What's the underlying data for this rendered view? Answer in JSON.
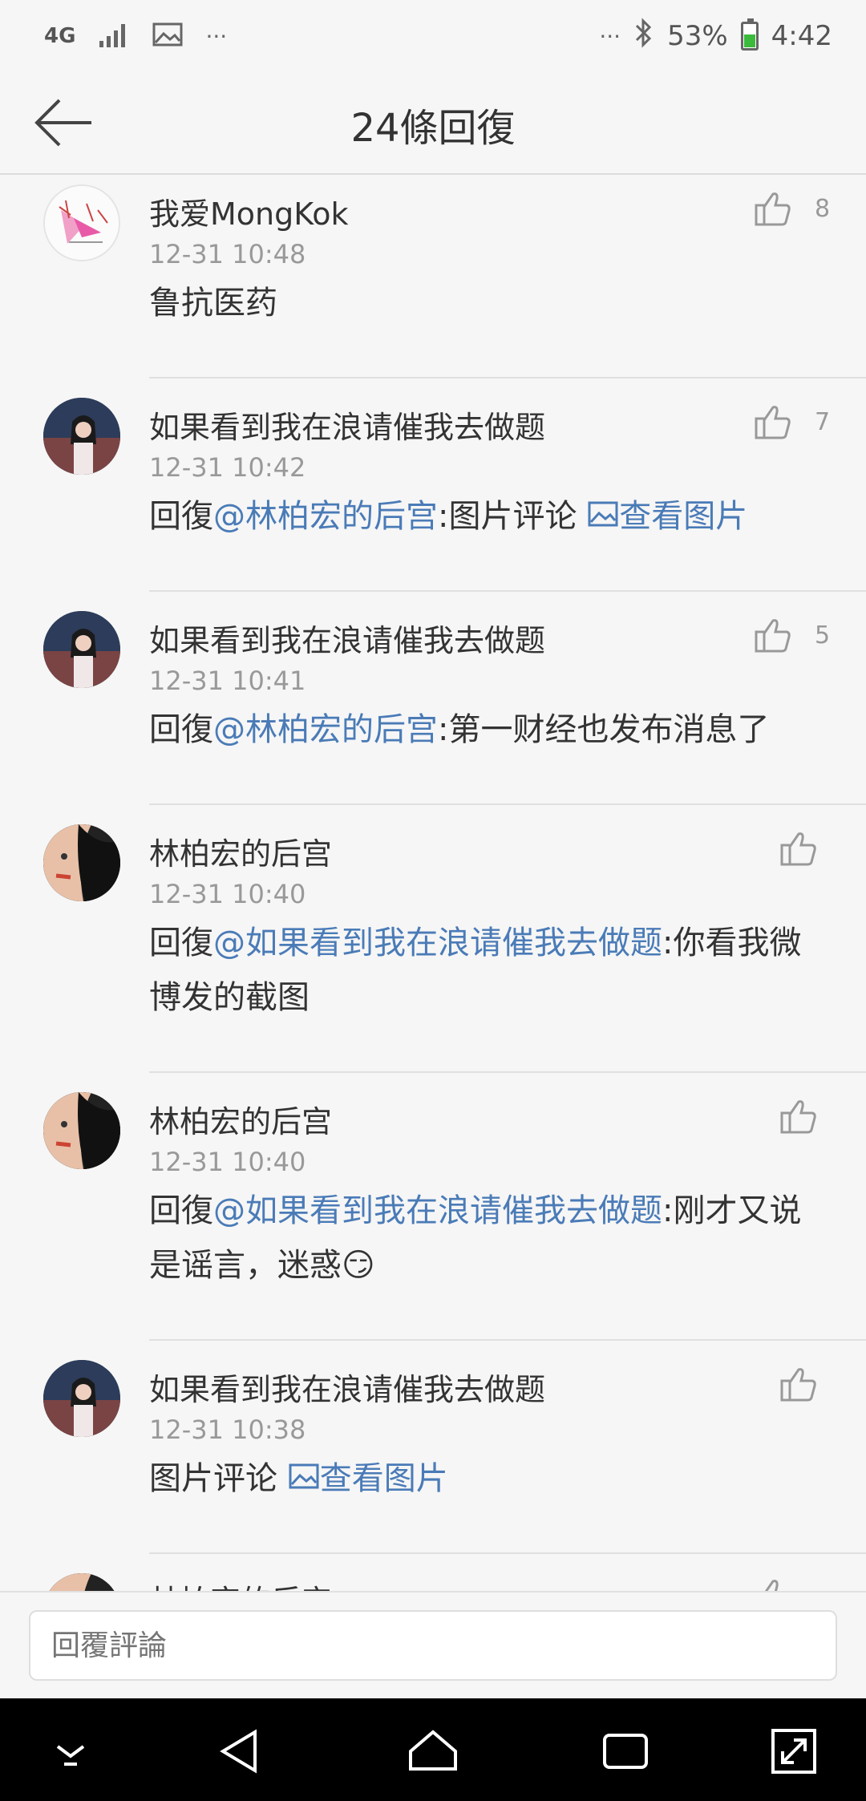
{
  "status_bar": {
    "network": "4G",
    "battery_percent": "53%",
    "battery_level": 0.53,
    "time": "4:42",
    "left_more": "···",
    "right_more": "···"
  },
  "header": {
    "title": "24條回復"
  },
  "comments": [
    {
      "username": "我爱MongKok",
      "time": "12-31 10:48",
      "likes": "8",
      "text": "鲁抗医药"
    },
    {
      "username": "如果看到我在浪请催我去做题",
      "time": "12-31 10:42",
      "likes": "7",
      "reply_prefix": "回復",
      "mention": "@林柏宏的后宫",
      "text": ":图片评论 ",
      "image_link": "查看图片"
    },
    {
      "username": "如果看到我在浪请催我去做题",
      "time": "12-31 10:41",
      "likes": "5",
      "reply_prefix": "回復",
      "mention": "@林柏宏的后宫",
      "text": ":第一财经也发布消息了"
    },
    {
      "username": "林柏宏的后宫",
      "time": "12-31 10:40",
      "likes": "",
      "reply_prefix": "回復",
      "mention": "@如果看到我在浪请催我去做题",
      "text": ":你看我微博发的截图"
    },
    {
      "username": "林柏宏的后宫",
      "time": "12-31 10:40",
      "likes": "",
      "reply_prefix": "回復",
      "mention": "@如果看到我在浪请催我去做题",
      "text": ":刚才又说是谣言，迷惑",
      "emoji": "😏"
    },
    {
      "username": "如果看到我在浪请催我去做题",
      "time": "12-31 10:38",
      "likes": "",
      "text": "图片评论 ",
      "image_link": "查看图片"
    },
    {
      "username": "林柏宏的后宫"
    }
  ],
  "reply_bar": {
    "placeholder": "回覆評論"
  },
  "colors": {
    "link": "#4a7bb7",
    "background": "#f6f6f6",
    "battery": "#3cba3c"
  },
  "icons": [
    "back-arrow-icon",
    "thumbs-up-icon",
    "image-icon",
    "bluetooth-icon",
    "signal-icon",
    "battery-icon"
  ]
}
